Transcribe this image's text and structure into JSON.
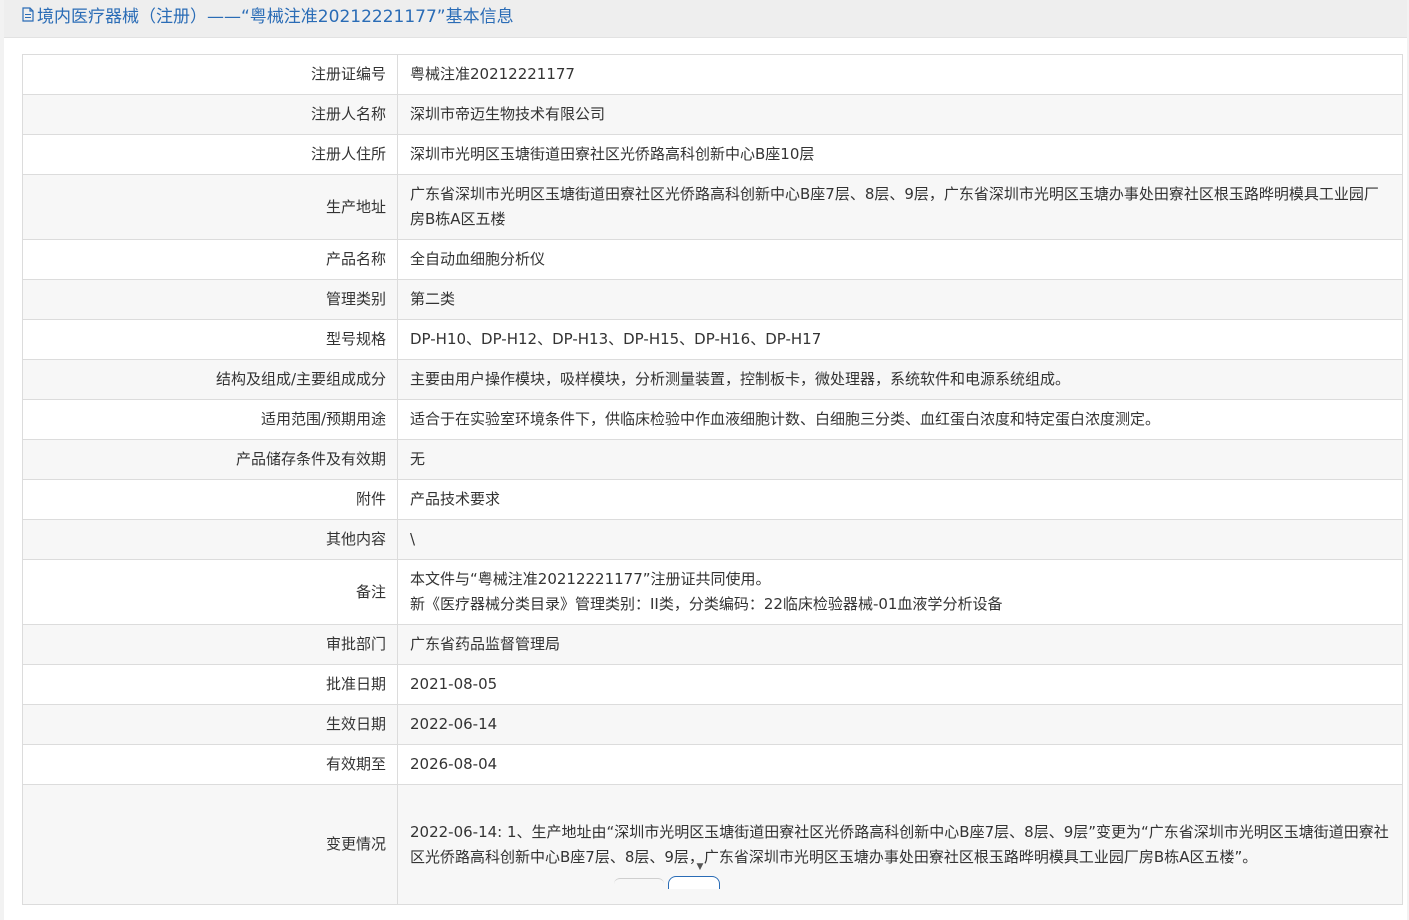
{
  "header": {
    "title": "境内医疗器械（注册）——“粤械注准20212221177”基本信息",
    "icon": "document-icon"
  },
  "rows": [
    {
      "label": "注册证编号",
      "value": [
        "粤械注准20212221177"
      ]
    },
    {
      "label": "注册人名称",
      "value": [
        "深圳市帝迈生物技术有限公司"
      ]
    },
    {
      "label": "注册人住所",
      "value": [
        "深圳市光明区玉塘街道田寮社区光侨路高科创新中心B座10层"
      ]
    },
    {
      "label": "生产地址",
      "value": [
        "广东省深圳市光明区玉塘街道田寮社区光侨路高科创新中心B座7层、8层、9层，广东省深圳市光明区玉塘办事处田寮社区根玉路晔明模具工业园厂房B栋A区五楼"
      ]
    },
    {
      "label": "产品名称",
      "value": [
        "全自动血细胞分析仪"
      ]
    },
    {
      "label": "管理类别",
      "value": [
        "第二类"
      ]
    },
    {
      "label": "型号规格",
      "value": [
        "DP-H10、DP-H12、DP-H13、DP-H15、DP-H16、DP-H17"
      ]
    },
    {
      "label": "结构及组成/主要组成成分",
      "value": [
        "主要由用户操作模块，吸样模块，分析测量装置，控制板卡，微处理器，系统软件和电源系统组成。"
      ]
    },
    {
      "label": "适用范围/预期用途",
      "value": [
        "适合于在实验室环境条件下，供临床检验中作血液细胞计数、白细胞三分类、血红蛋白浓度和特定蛋白浓度测定。"
      ]
    },
    {
      "label": "产品储存条件及有效期",
      "value": [
        "无"
      ]
    },
    {
      "label": "附件",
      "value": [
        "产品技术要求"
      ]
    },
    {
      "label": "其他内容",
      "value": [
        "\\"
      ]
    },
    {
      "label": "备注",
      "value": [
        "本文件与“粤械注准20212221177”注册证共同使用。",
        "新《医疗器械分类目录》管理类别：II类，分类编码：22临床检验器械-01血液学分析设备"
      ]
    },
    {
      "label": "审批部门",
      "value": [
        "广东省药品监督管理局"
      ]
    },
    {
      "label": "批准日期",
      "value": [
        "2021-08-05"
      ]
    },
    {
      "label": "生效日期",
      "value": [
        "2022-06-14"
      ]
    },
    {
      "label": "有效期至",
      "value": [
        "2026-08-04"
      ]
    },
    {
      "label": "变更情况",
      "value": [
        "2022-06-14: 1、生产地址由“深圳市光明区玉塘街道田寮社区光侨路高科创新中心B座7层、8层、9层”变更为“广东省深圳市光明区玉塘街道田寮社区光侨路高科创新中心B座7层、8层、9层，广东省深圳市光明区玉塘办事处田寮社区根玉路晔明模具工业园厂房B栋A区五楼”。"
      ]
    }
  ],
  "colors": {
    "accent": "#2a6cb6",
    "border": "#dcdcdc",
    "row_alt": "#f7f7f7",
    "header_bg": "#eeeeee"
  }
}
